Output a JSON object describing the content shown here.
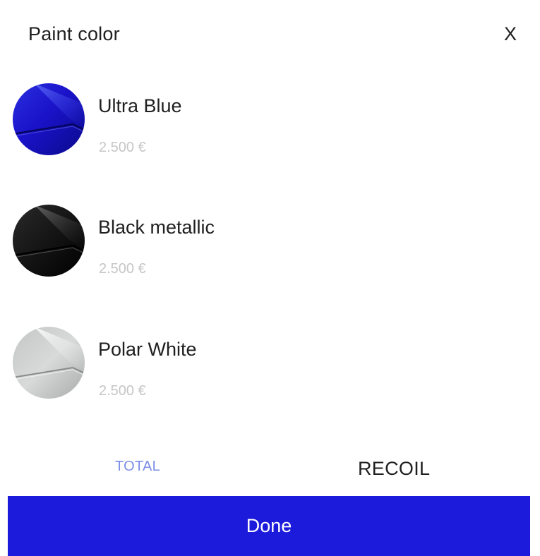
{
  "header": {
    "title": "Paint color",
    "close_label": "X"
  },
  "colors": [
    {
      "name": "Ultra Blue",
      "price": "2.500 €",
      "swatch_icon": "paint-swatch-blue-icon",
      "swatch_colors": {
        "base": "#1a12c9",
        "highlight": "#4b55f0",
        "shadow": "#0a0a8a"
      }
    },
    {
      "name": "Black metallic",
      "price": "2.500 €",
      "swatch_icon": "paint-swatch-black-icon",
      "swatch_colors": {
        "base": "#141414",
        "highlight": "#5a5a5a",
        "shadow": "#000000"
      }
    },
    {
      "name": "Polar White",
      "price": "2.500 €",
      "swatch_icon": "paint-swatch-white-icon",
      "swatch_colors": {
        "base": "#d2d4d4",
        "highlight": "#f0f0f0",
        "shadow": "#a9abab"
      }
    }
  ],
  "footer": {
    "total_label": "TOTAL",
    "total_value": "RECOIL",
    "done_label": "Done"
  },
  "theme": {
    "accent": "#1c1adb",
    "total_label_color": "#7b8ee6",
    "price_color": "#c6c6c6",
    "text_color": "#1f1f1f"
  }
}
